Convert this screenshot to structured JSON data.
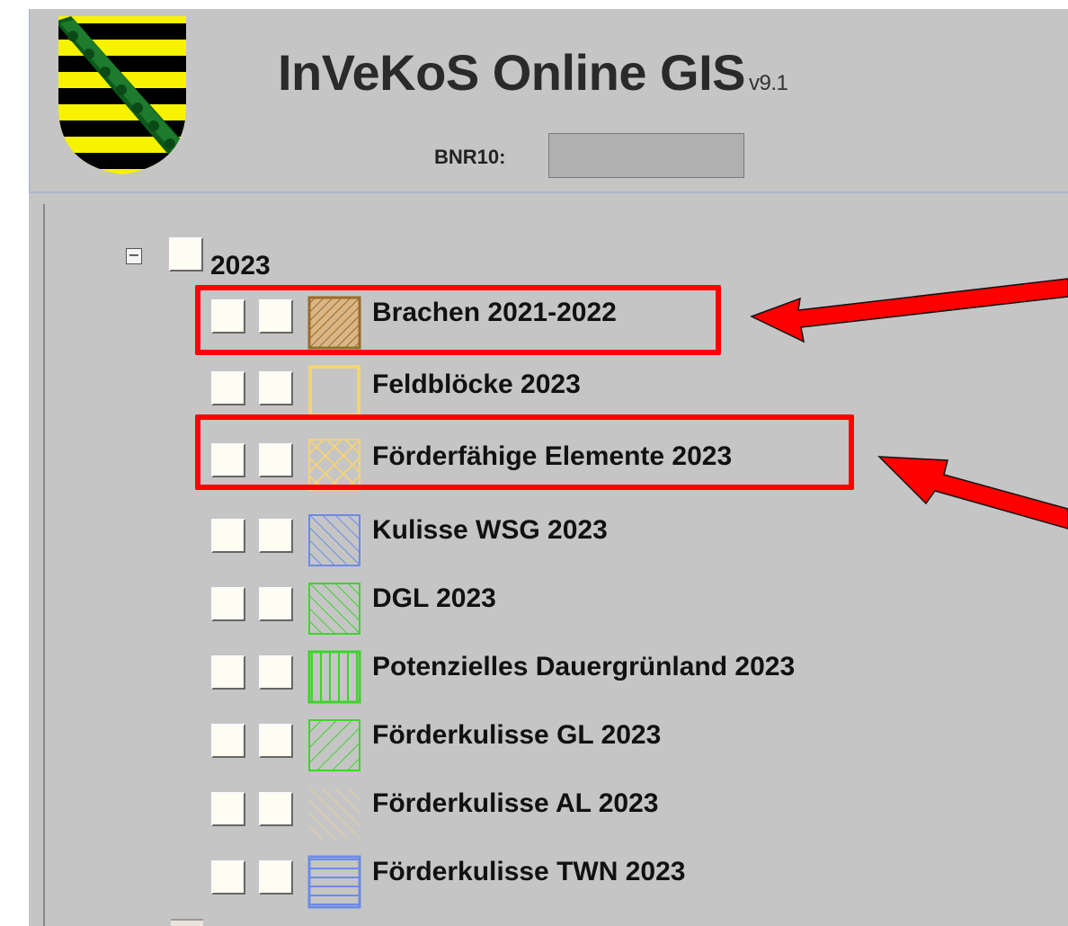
{
  "header": {
    "title": "InVeKoS Online GIS",
    "version": "v9.1",
    "bnr_label": "BNR10:",
    "bnr_value": ""
  },
  "tree": {
    "group_label": "2023",
    "expander_symbol": "−",
    "layers": [
      {
        "label": "Brachen 2021-2022",
        "legend": "diagonal-hatch-brown",
        "color": "#9c6a2c",
        "highlighted": true
      },
      {
        "label": "Feldblöcke 2023",
        "legend": "outline-yellow",
        "color": "#f3d27a",
        "highlighted": false
      },
      {
        "label": "Förderfähige Elemente 2023",
        "legend": "cross-hatch-yellow",
        "color": "#f3d27a",
        "highlighted": true
      },
      {
        "label": "Kulisse WSG 2023",
        "legend": "diagonal-hatch-blue",
        "color": "#6b8be6",
        "highlighted": false
      },
      {
        "label": "DGL 2023",
        "legend": "diagonal-hatch-green",
        "color": "#3ed42a",
        "highlighted": false
      },
      {
        "label": "Potenzielles Dauergrünland 2023",
        "legend": "vertical-lines-green",
        "color": "#3ed42a",
        "highlighted": false
      },
      {
        "label": "Förderkulisse GL 2023",
        "legend": "back-diagonal-green",
        "color": "#3ed42a",
        "highlighted": false
      },
      {
        "label": "Förderkulisse AL 2023",
        "legend": "diagonal-hatch-tan",
        "color": "#e6cfa6",
        "highlighted": false
      },
      {
        "label": "Förderkulisse TWN 2023",
        "legend": "horizontal-lines-blue",
        "color": "#6b8be6",
        "highlighted": false
      }
    ]
  },
  "colors": {
    "panel_bg": "#c5c5c5",
    "highlight": "#ff0000",
    "arrow": "#ff0000",
    "checkbox_fill": "#fffcf2"
  },
  "icons": {
    "logo": "coat-of-arms-saxony-icon",
    "expander": "minus-box-icon"
  }
}
